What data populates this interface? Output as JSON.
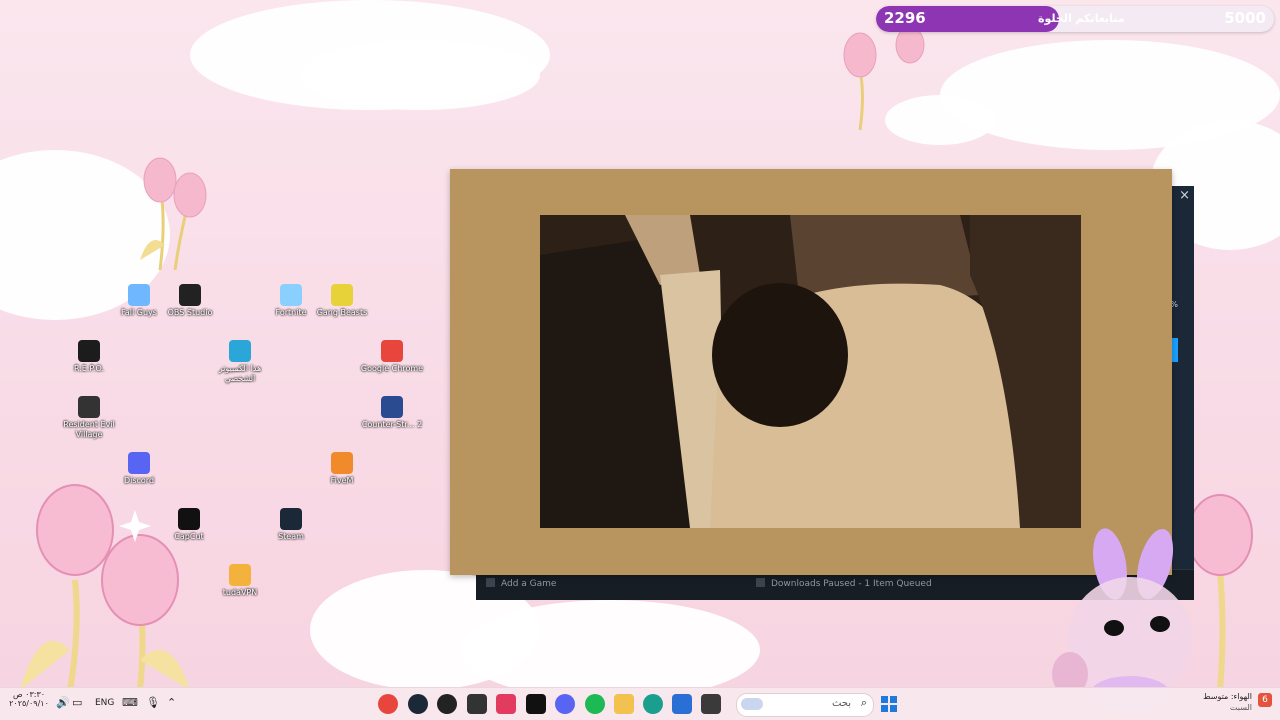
{
  "goal": {
    "current": "2296",
    "label": "متابعاتكم الحلوة",
    "target": "5000",
    "progress": 0.4592,
    "fill_color": "#8e35b3"
  },
  "desktop_icons": [
    {
      "label": "Fall Guys",
      "icon": "fall-guys-icon",
      "color": "#6fb7ff"
    },
    {
      "label": "OBS Studio",
      "icon": "obs-icon",
      "color": "#222222"
    },
    {
      "label": "Fortnite",
      "icon": "fortnite-icon",
      "color": "#8ad0ff"
    },
    {
      "label": "Gang Beasts",
      "icon": "gang-beasts-icon",
      "color": "#e8d23a"
    },
    {
      "label": "R.E.P.O.",
      "icon": "repo-icon",
      "color": "#1c1c1c"
    },
    {
      "label": "هذا الكمبيوتر الشخصي",
      "icon": "this-pc-icon",
      "color": "#2aa7d8"
    },
    {
      "label": "Google Chrome",
      "icon": "chrome-icon",
      "color": "#e8453c"
    },
    {
      "label": "Resident Evil Village",
      "icon": "resident-evil-icon",
      "color": "#333333"
    },
    {
      "label": "Counter-Str... 2",
      "icon": "counter-strike-icon",
      "color": "#2a4b8f"
    },
    {
      "label": "Discord",
      "icon": "discord-icon",
      "color": "#5865f2"
    },
    {
      "label": "FiveM",
      "icon": "fivem-icon",
      "color": "#f08a2a"
    },
    {
      "label": "CapCut",
      "icon": "capcut-icon",
      "color": "#111111"
    },
    {
      "label": "Steam",
      "icon": "steam-icon",
      "color": "#1b2838"
    },
    {
      "label": "tudaVPN",
      "icon": "vpn-icon",
      "color": "#f3b23b"
    }
  ],
  "steam": {
    "add_game": "Add a Game",
    "downloads": "Downloads Paused - 1 Item Queued",
    "percent": "%",
    "close_glyph": "×"
  },
  "taskbar": {
    "time": "٠٣:٣٠ ص",
    "date": "٢٠٢٥/٠٩/١٠",
    "language": "ENG",
    "search_placeholder": "بحث",
    "weather_title": "الهواء: متوسط",
    "weather_sub": "السبت",
    "notification_count": "6",
    "apps": [
      "chrome",
      "steam",
      "obs",
      "epic",
      "tiktok-studio",
      "tiktok",
      "discord",
      "spotify",
      "file-explorer",
      "edge",
      "store",
      "terminal"
    ]
  }
}
